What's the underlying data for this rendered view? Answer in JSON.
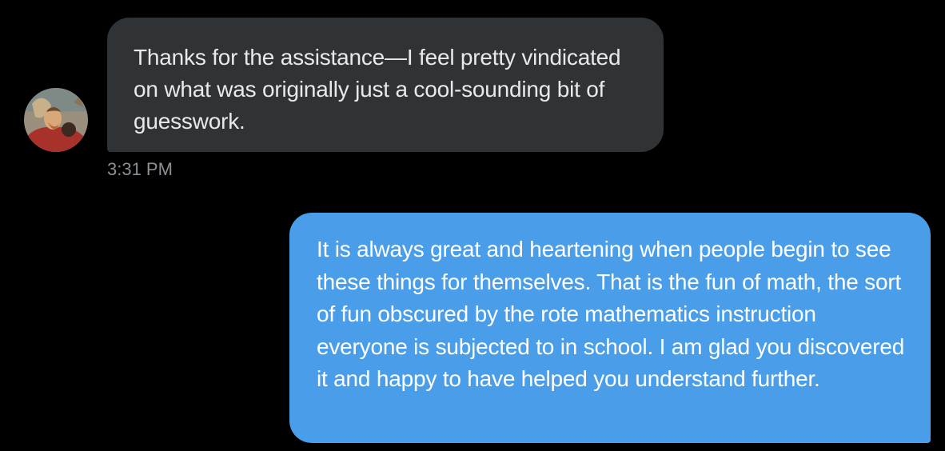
{
  "conversation": {
    "incoming": {
      "avatar_icon": "user-avatar-photo",
      "text": "Thanks for the assistance—I feel pretty vindicated on what was originally just a cool-sounding bit of guesswork.",
      "timestamp": "3:31 PM",
      "bubble_color": "#2f3336"
    },
    "outgoing": {
      "text": "It is always great and heartening when people begin to see these things for themselves. That is the fun of math, the sort of fun obscured by the rote mathematics instruction everyone is subjected to in school. I am glad you discovered it and happy to have helped you understand further.",
      "bubble_color": "#4a9ee9"
    }
  },
  "colors": {
    "background": "#000000",
    "timestamp": "#8b9096"
  }
}
